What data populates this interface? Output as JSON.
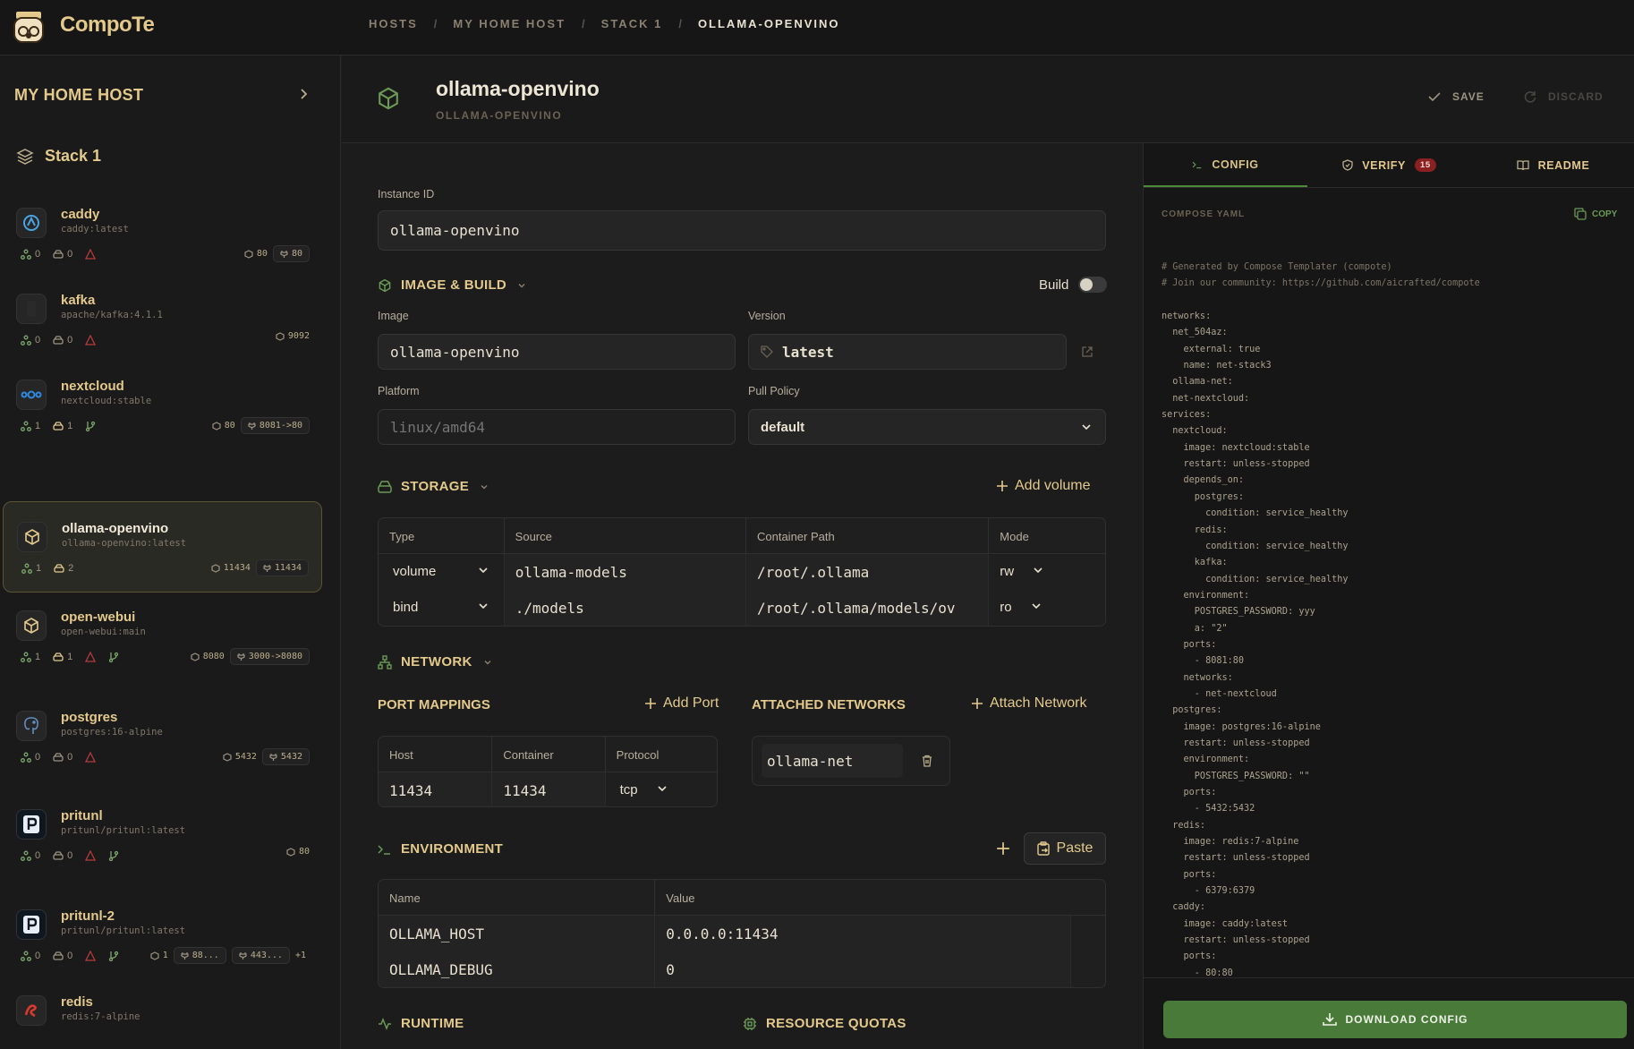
{
  "app": {
    "brand": "CompoTe"
  },
  "breadcrumb": [
    "HOSTS",
    "/",
    "MY HOME HOST",
    "/",
    "STACK 1",
    "/",
    "OLLAMA-OPENVINO"
  ],
  "sidebar": {
    "host_title": "MY HOME HOST",
    "stack_label": "Stack 1",
    "services": [
      {
        "name": "caddy",
        "image": "caddy:latest",
        "networks": "0",
        "volumes": "0",
        "warn": true,
        "ports": [
          "80"
        ],
        "mapped": [
          "80"
        ]
      },
      {
        "name": "kafka",
        "image": "apache/kafka:4.1.1",
        "networks": "0",
        "volumes": "0",
        "warn": true,
        "ports": [
          "9092"
        ],
        "mapped": []
      },
      {
        "name": "nextcloud",
        "image": "nextcloud:stable",
        "networks": "1",
        "volumes": "1",
        "warn": false,
        "ports": [
          "80"
        ],
        "mapped": [
          "8081->80"
        ]
      },
      {
        "name": "ollama-openvino",
        "image": "ollama-openvino:latest",
        "networks": "1",
        "volumes": "2",
        "warn": false,
        "ports": [
          "11434"
        ],
        "mapped": [
          "11434"
        ]
      },
      {
        "name": "open-webui",
        "image": "open-webui:main",
        "networks": "1",
        "volumes": "1",
        "warn": true,
        "ports": [
          "8080"
        ],
        "mapped": [
          "3000->8080"
        ]
      },
      {
        "name": "postgres",
        "image": "postgres:16-alpine",
        "networks": "0",
        "volumes": "0",
        "warn": true,
        "ports": [
          "5432"
        ],
        "mapped": [
          "5432"
        ]
      },
      {
        "name": "pritunl",
        "image": "pritunl/pritunl:latest",
        "networks": "0",
        "volumes": "0",
        "warn": true,
        "ports": [
          "80"
        ],
        "mapped": []
      },
      {
        "name": "pritunl-2",
        "image": "pritunl/pritunl:latest",
        "networks": "0",
        "volumes": "0",
        "warn": true,
        "ports": [
          "1"
        ],
        "mapped": [
          "88...",
          "443..."
        ],
        "more": "+1"
      },
      {
        "name": "redis",
        "image": "redis:7-alpine"
      }
    ]
  },
  "header": {
    "title": "ollama-openvino",
    "subtitle": "OLLAMA-OPENVINO",
    "save_label": "SAVE",
    "discard_label": "DISCARD"
  },
  "editor": {
    "instance_id_label": "Instance ID",
    "instance_id": "ollama-openvino",
    "image_build": {
      "title": "IMAGE & BUILD",
      "build_label": "Build",
      "image_label": "Image",
      "image": "ollama-openvino",
      "version_label": "Version",
      "version": "latest",
      "platform_label": "Platform",
      "platform_placeholder": "linux/amd64",
      "pull_policy_label": "Pull Policy",
      "pull_policy": "default"
    },
    "storage": {
      "title": "STORAGE",
      "add_label": "Add volume",
      "columns": [
        "Type",
        "Source",
        "Container Path",
        "Mode"
      ],
      "rows": [
        {
          "type": "volume",
          "source": "ollama-models",
          "path": "/root/.ollama",
          "mode": "rw"
        },
        {
          "type": "bind",
          "source": "./models",
          "path": "/root/.ollama/models/ov",
          "mode": "ro"
        }
      ]
    },
    "network": {
      "title": "NETWORK",
      "port_mappings_label": "PORT MAPPINGS",
      "add_port_label": "Add Port",
      "attached_label": "ATTACHED NETWORKS",
      "attach_label": "Attach Network",
      "port_columns": [
        "Host",
        "Container",
        "Protocol"
      ],
      "ports": [
        {
          "host": "11434",
          "container": "11434",
          "protocol": "tcp"
        }
      ],
      "networks": [
        "ollama-net"
      ]
    },
    "environment": {
      "title": "ENVIRONMENT",
      "paste_label": "Paste",
      "columns": [
        "Name",
        "Value"
      ],
      "rows": [
        {
          "name": "OLLAMA_HOST",
          "value": "0.0.0.0:11434"
        },
        {
          "name": "OLLAMA_DEBUG",
          "value": "0"
        }
      ]
    },
    "runtime_label": "RUNTIME",
    "quotas_label": "RESOURCE QUOTAS"
  },
  "right_panel": {
    "tabs": [
      {
        "label": "CONFIG"
      },
      {
        "label": "VERIFY",
        "badge": "15"
      },
      {
        "label": "README"
      }
    ],
    "yaml_label": "COMPOSE YAML",
    "copy_label": "COPY",
    "yaml_lines": [
      "# Generated by Compose Templater (compote)",
      "# Join our community: https://github.com/aicrafted/compote",
      "",
      "networks:",
      "  net_504az:",
      "    external: true",
      "    name: net-stack3",
      "  ollama-net:",
      "  net-nextcloud:",
      "services:",
      "  nextcloud:",
      "    image: nextcloud:stable",
      "    restart: unless-stopped",
      "    depends_on:",
      "      postgres:",
      "        condition: service_healthy",
      "      redis:",
      "        condition: service_healthy",
      "      kafka:",
      "        condition: service_healthy",
      "    environment:",
      "      POSTGRES_PASSWORD: yyy",
      "      a: \"2\"",
      "    ports:",
      "      - 8081:80",
      "    networks:",
      "      - net-nextcloud",
      "  postgres:",
      "    image: postgres:16-alpine",
      "    restart: unless-stopped",
      "    environment:",
      "      POSTGRES_PASSWORD: \"\"",
      "    ports:",
      "      - 5432:5432",
      "  redis:",
      "    image: redis:7-alpine",
      "    restart: unless-stopped",
      "    ports:",
      "      - 6379:6379",
      "  caddy:",
      "    image: caddy:latest",
      "    restart: unless-stopped",
      "    ports:",
      "      - 80:80"
    ],
    "download_label": "DOWNLOAD CONFIG"
  },
  "colors": {
    "accent": "#e3c98c",
    "green": "#4a7a3a",
    "warn": "#b83a3a",
    "bg": "#1c1c1c"
  }
}
